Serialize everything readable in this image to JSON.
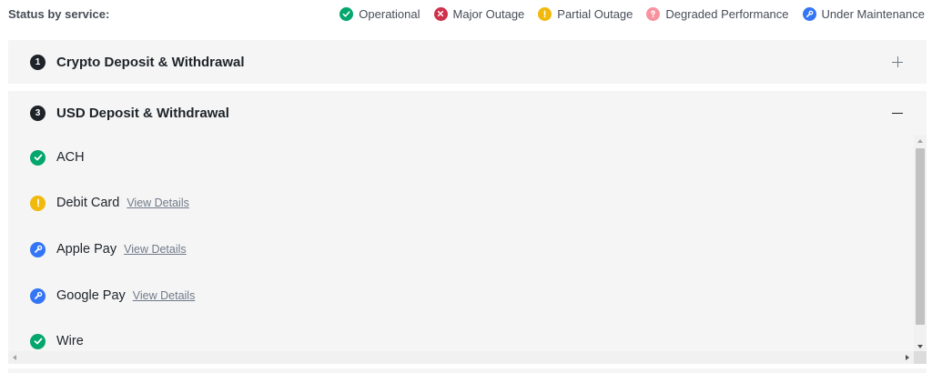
{
  "legend": {
    "title": "Status by service:",
    "items": [
      {
        "label": "Operational",
        "icon": "check-circle-icon",
        "color": "#03a66d"
      },
      {
        "label": "Major Outage",
        "icon": "x-circle-icon",
        "color": "#cf304a"
      },
      {
        "label": "Partial Outage",
        "icon": "exclamation-circle-icon",
        "color": "#f0b90b"
      },
      {
        "label": "Degraded Performance",
        "icon": "question-circle-icon",
        "color": "#f6939f"
      },
      {
        "label": "Under Maintenance",
        "icon": "wrench-circle-icon",
        "color": "#3375f6"
      }
    ]
  },
  "panels": [
    {
      "count": "1",
      "title": "Crypto Deposit & Withdrawal",
      "expanded": false,
      "toggle": "plus-icon"
    },
    {
      "count": "3",
      "title": "USD Deposit & Withdrawal",
      "expanded": true,
      "toggle": "minus-icon"
    }
  ],
  "services": [
    {
      "name": "ACH",
      "status": "Operational",
      "icon": "check-circle-icon",
      "link": ""
    },
    {
      "name": "Debit Card",
      "status": "Partial Outage",
      "icon": "exclamation-circle-icon",
      "link": "View Details"
    },
    {
      "name": "Apple Pay",
      "status": "Under Maintenance",
      "icon": "wrench-circle-icon",
      "link": "View Details"
    },
    {
      "name": "Google Pay",
      "status": "Under Maintenance",
      "icon": "wrench-circle-icon",
      "link": "View Details"
    },
    {
      "name": "Wire",
      "status": "Operational",
      "icon": "check-circle-icon",
      "link": ""
    }
  ]
}
